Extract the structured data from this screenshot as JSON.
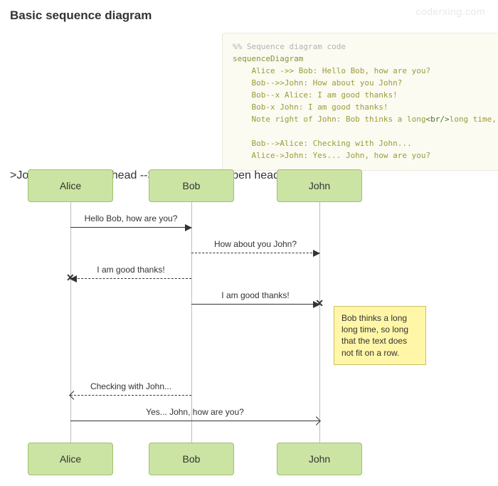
{
  "title": "Basic sequence diagram",
  "watermark": "coderxing.com",
  "code": {
    "comment": "%% Sequence diagram code",
    "header": "sequenceDiagram",
    "l1": "    Alice ->> Bob: Hello Bob, how are you?",
    "l2": "    Bob-->>John: How about you John?",
    "l3": "    Bob--x Alice: I am good thanks!",
    "l4": "    Bob-x John: I am good thanks!",
    "l5a": "    Note right of John: Bob thinks a long",
    "l5b": "<br/>",
    "l5c": "long time, so long<",
    "l6": "",
    "l7": "    Bob-->Alice: Checking with John...",
    "l8": "    Alice->John: Yes... John, how are you?"
  },
  "actors": {
    "alice": "Alice",
    "bob": "Bob",
    "john": "John"
  },
  "messages": {
    "m1": "Hello Bob, how are you?",
    "m2": "How about you John?",
    "m3": "I am good thanks!",
    "m4": "I am good thanks!",
    "m5": "Checking with John...",
    "m6": "Yes... John, how are you?"
  },
  "note": "Bob thinks a long long time, so long that the text does not fit on a row.",
  "chart_data": {
    "type": "sequence",
    "actors": [
      "Alice",
      "Bob",
      "John"
    ],
    "messages": [
      {
        "from": "Alice",
        "to": "Bob",
        "text": "Hello Bob, how are you?",
        "line": "solid",
        "arrow": "solid"
      },
      {
        "from": "Bob",
        "to": "John",
        "text": "How about you John?",
        "line": "dashed",
        "arrow": "solid"
      },
      {
        "from": "Bob",
        "to": "Alice",
        "text": "I am good thanks!",
        "line": "dashed",
        "arrow": "x"
      },
      {
        "from": "Bob",
        "to": "John",
        "text": "I am good thanks!",
        "line": "solid",
        "arrow": "x"
      },
      {
        "type": "note",
        "placement": "right of",
        "actor": "John",
        "text": "Bob thinks a long long time, so long that the text does not fit on a row."
      },
      {
        "from": "Bob",
        "to": "Alice",
        "text": "Checking with John...",
        "line": "dashed",
        "arrow": "open"
      },
      {
        "from": "Alice",
        "to": "John",
        "text": "Yes... John, how are you?",
        "line": "solid",
        "arrow": "open"
      }
    ]
  }
}
